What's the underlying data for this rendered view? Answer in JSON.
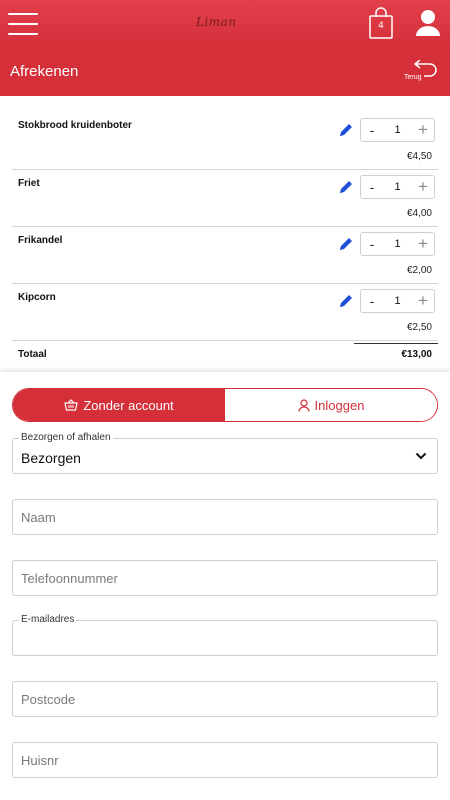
{
  "app": {
    "logo_text": "Liman",
    "cart_count": "4",
    "accent": "#d52f3a"
  },
  "header": {
    "title": "Afrekenen",
    "back_label": "Terug"
  },
  "items": [
    {
      "name": "Stokbrood kruidenboter",
      "minus": "-",
      "qty": "1",
      "plus": "+",
      "price": "€4,50"
    },
    {
      "name": "Friet",
      "minus": "-",
      "qty": "1",
      "plus": "+",
      "price": "€4,00"
    },
    {
      "name": "Frikandel",
      "minus": "-",
      "qty": "1",
      "plus": "+",
      "price": "€2,00"
    },
    {
      "name": "Kipcorn",
      "minus": "-",
      "qty": "1",
      "plus": "+",
      "price": "€2,50"
    }
  ],
  "total": {
    "label": "Totaal",
    "value": "€13,00"
  },
  "form": {
    "toggle": {
      "guest": "Zonder account",
      "login": "Inloggen"
    },
    "delivery": {
      "label": "Bezorgen of afhalen",
      "value": "Bezorgen"
    },
    "name_placeholder": "Naam",
    "phone_placeholder": "Telefoonnummer",
    "email_label": "E-mailadres",
    "postcode_placeholder": "Postcode",
    "housenr_placeholder": "Huisnr"
  }
}
